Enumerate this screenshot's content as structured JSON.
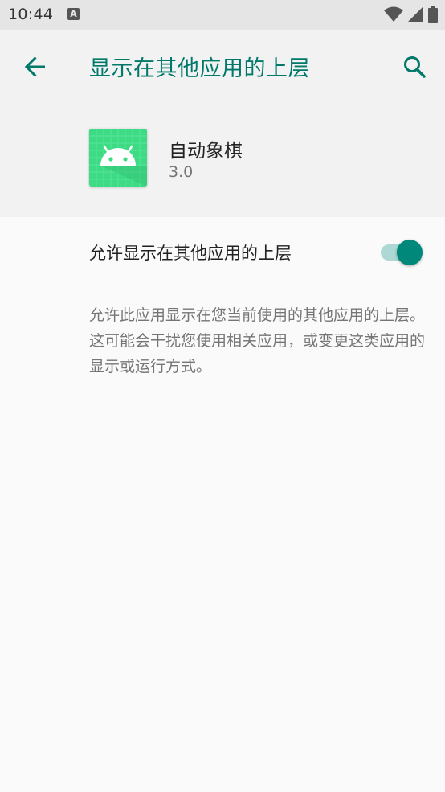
{
  "status_bar": {
    "time": "10:44",
    "notification_letter": "A"
  },
  "header": {
    "title": "显示在其他应用的上层",
    "accent_color": "#00796b"
  },
  "app": {
    "name": "自动象棋",
    "version": "3.0",
    "icon": "android-robot-icon",
    "icon_color": "#3ddc84"
  },
  "setting": {
    "label": "允许显示在其他应用的上层",
    "enabled": true,
    "summary": "允许此应用显示在您当前使用的其他应用的上层。这可能会干扰您使用相关应用，或变更这类应用的显示或运行方式。"
  }
}
